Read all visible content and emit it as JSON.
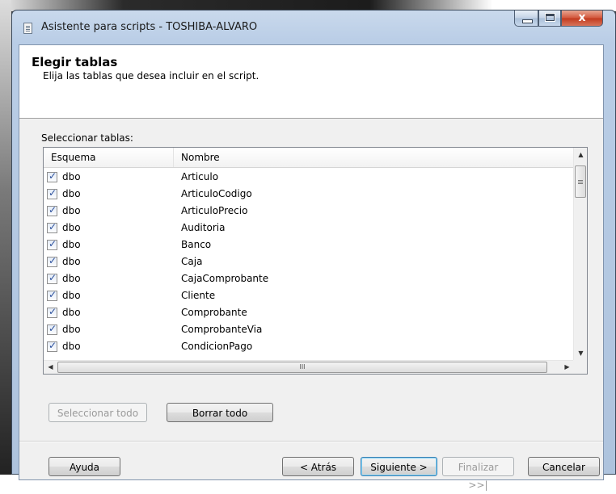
{
  "window": {
    "title": "Asistente para scripts - TOSHIBA-ALVARO",
    "close_glyph": "x"
  },
  "header": {
    "title": "Elegir tablas",
    "subtitle": "Elija las tablas que desea incluir en el script."
  },
  "section_label": "Seleccionar tablas:",
  "table": {
    "columns": [
      "Esquema",
      "Nombre"
    ],
    "rows": [
      {
        "schema": "dbo",
        "name": "Articulo",
        "checked": true
      },
      {
        "schema": "dbo",
        "name": "ArticuloCodigo",
        "checked": true
      },
      {
        "schema": "dbo",
        "name": "ArticuloPrecio",
        "checked": true
      },
      {
        "schema": "dbo",
        "name": "Auditoria",
        "checked": true
      },
      {
        "schema": "dbo",
        "name": "Banco",
        "checked": true
      },
      {
        "schema": "dbo",
        "name": "Caja",
        "checked": true
      },
      {
        "schema": "dbo",
        "name": "CajaComprobante",
        "checked": true
      },
      {
        "schema": "dbo",
        "name": "Cliente",
        "checked": true
      },
      {
        "schema": "dbo",
        "name": "Comprobante",
        "checked": true
      },
      {
        "schema": "dbo",
        "name": "ComprobanteVia",
        "checked": true
      },
      {
        "schema": "dbo",
        "name": "CondicionPago",
        "checked": true
      }
    ],
    "hscroll_grip": "III"
  },
  "buttons": {
    "select_all": "Seleccionar todo",
    "clear_all": "Borrar todo",
    "help": "Ayuda",
    "back": "< Atrás",
    "next": "Siguiente >",
    "finish": "Finalizar >>|",
    "cancel": "Cancelar"
  },
  "icons": {
    "title": "document-icon",
    "scroll_up": "arrow-up-icon",
    "scroll_down": "arrow-down-icon",
    "scroll_left": "arrow-left-icon",
    "scroll_right": "arrow-right-icon"
  }
}
